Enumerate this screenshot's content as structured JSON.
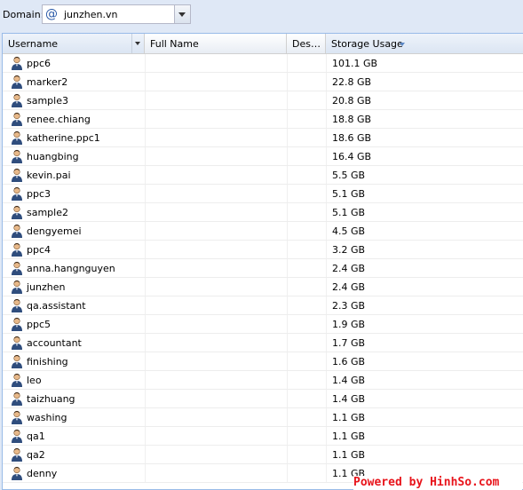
{
  "toolbar": {
    "domain_label": "Domain:",
    "domain_icon": "at-sign-icon",
    "domain_value": "junzhen.vn"
  },
  "grid": {
    "columns": {
      "username": "Username",
      "full_name": "Full Name",
      "description": "Des…",
      "storage_usage": "Storage Usage"
    },
    "sort": {
      "column": "storage_usage",
      "direction": "descending"
    },
    "rows": [
      {
        "username": "ppc6",
        "storage": "101.1 GB"
      },
      {
        "username": "marker2",
        "storage": "22.8 GB"
      },
      {
        "username": "sample3",
        "storage": "20.8 GB"
      },
      {
        "username": "renee.chiang",
        "storage": "18.8 GB"
      },
      {
        "username": "katherine.ppc1",
        "storage": "18.6 GB"
      },
      {
        "username": "huangbing",
        "storage": "16.4 GB"
      },
      {
        "username": "kevin.pai",
        "storage": "5.5 GB"
      },
      {
        "username": "ppc3",
        "storage": "5.1 GB"
      },
      {
        "username": "sample2",
        "storage": "5.1 GB"
      },
      {
        "username": "dengyemei",
        "storage": "4.5 GB"
      },
      {
        "username": "ppc4",
        "storage": "3.2 GB"
      },
      {
        "username": "anna.hangnguyen",
        "storage": "2.4 GB"
      },
      {
        "username": "junzhen",
        "storage": "2.4 GB"
      },
      {
        "username": "qa.assistant",
        "storage": "2.3 GB"
      },
      {
        "username": "ppc5",
        "storage": "1.9 GB"
      },
      {
        "username": "accountant",
        "storage": "1.7 GB"
      },
      {
        "username": "finishing",
        "storage": "1.6 GB"
      },
      {
        "username": "leo",
        "storage": "1.4 GB"
      },
      {
        "username": "taizhuang",
        "storage": "1.4 GB"
      },
      {
        "username": "washing",
        "storage": "1.1 GB"
      },
      {
        "username": "qa1",
        "storage": "1.1 GB"
      },
      {
        "username": "qa2",
        "storage": "1.1 GB"
      },
      {
        "username": "denny",
        "storage": "1.1 GB"
      }
    ]
  },
  "watermark": "Powered by HinhSo.com"
}
